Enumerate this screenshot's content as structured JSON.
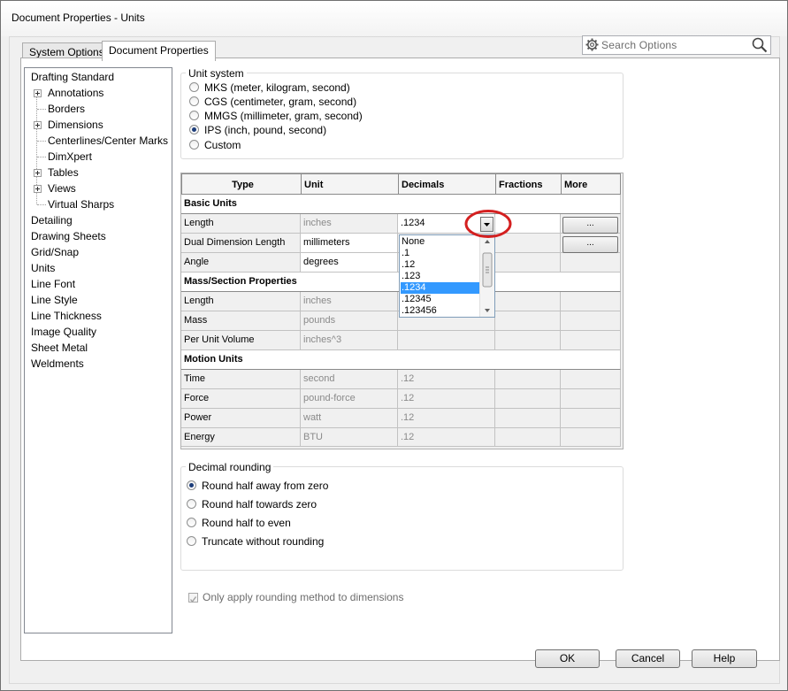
{
  "window": {
    "title": "Document Properties - Units"
  },
  "tabs": [
    {
      "label": "System Options",
      "active": false
    },
    {
      "label": "Document Properties",
      "active": true
    }
  ],
  "search": {
    "placeholder": "Search Options"
  },
  "tree": [
    {
      "label": "Drafting Standard",
      "level": 0
    },
    {
      "label": "Annotations",
      "level": 1,
      "expandable": true
    },
    {
      "label": "Borders",
      "level": 1
    },
    {
      "label": "Dimensions",
      "level": 1,
      "expandable": true
    },
    {
      "label": "Centerlines/Center Marks",
      "level": 1
    },
    {
      "label": "DimXpert",
      "level": 1
    },
    {
      "label": "Tables",
      "level": 1,
      "expandable": true
    },
    {
      "label": "Views",
      "level": 1,
      "expandable": true
    },
    {
      "label": "Virtual Sharps",
      "level": 1
    },
    {
      "label": "Detailing",
      "level": 0
    },
    {
      "label": "Drawing Sheets",
      "level": 0
    },
    {
      "label": "Grid/Snap",
      "level": 0
    },
    {
      "label": "Units",
      "level": 0,
      "selected": true
    },
    {
      "label": "Line Font",
      "level": 0
    },
    {
      "label": "Line Style",
      "level": 0
    },
    {
      "label": "Line Thickness",
      "level": 0
    },
    {
      "label": "Image Quality",
      "level": 0
    },
    {
      "label": "Sheet Metal",
      "level": 0
    },
    {
      "label": "Weldments",
      "level": 0
    }
  ],
  "unit_system": {
    "title": "Unit system",
    "options": [
      {
        "label": "MKS  (meter, kilogram, second)",
        "checked": false
      },
      {
        "label": "CGS  (centimeter, gram, second)",
        "checked": false
      },
      {
        "label": "MMGS  (millimeter, gram, second)",
        "checked": false
      },
      {
        "label": "IPS  (inch, pound, second)",
        "checked": true
      },
      {
        "label": "Custom",
        "checked": false
      }
    ]
  },
  "grid": {
    "headers": [
      "Type",
      "Unit",
      "Decimals",
      "Fractions",
      "More"
    ],
    "sections": {
      "basic": "Basic Units",
      "mass": "Mass/Section Properties",
      "motion": "Motion Units"
    },
    "rows": {
      "length": {
        "type": "Length",
        "unit": "inches",
        "decimals": ".1234"
      },
      "dual": {
        "type": "Dual Dimension Length",
        "unit": "millimeters"
      },
      "angle": {
        "type": "Angle",
        "unit": "degrees"
      },
      "mlength": {
        "type": "Length",
        "unit": "inches"
      },
      "mass": {
        "type": "Mass",
        "unit": "pounds"
      },
      "volume": {
        "type": "Per Unit Volume",
        "unit": "inches^3"
      },
      "time": {
        "type": "Time",
        "unit": "second",
        "decimals": ".12"
      },
      "force": {
        "type": "Force",
        "unit": "pound-force",
        "decimals": ".12"
      },
      "power": {
        "type": "Power",
        "unit": "watt",
        "decimals": ".12"
      },
      "energy": {
        "type": "Energy",
        "unit": "BTU",
        "decimals": ".12"
      }
    },
    "more_label": "...",
    "dropdown_options": [
      "None",
      ".1",
      ".12",
      ".123",
      ".1234",
      ".12345",
      ".123456"
    ],
    "dropdown_selected": ".1234"
  },
  "rounding": {
    "title": "Decimal rounding",
    "options": [
      {
        "label": "Round half away from zero",
        "checked": true
      },
      {
        "label": "Round half towards zero",
        "checked": false
      },
      {
        "label": "Round half to even",
        "checked": false
      },
      {
        "label": "Truncate without rounding",
        "checked": false
      }
    ],
    "only_apply_label": "Only apply rounding method to dimensions"
  },
  "buttons": {
    "ok": "OK",
    "cancel": "Cancel",
    "help": "Help"
  },
  "colors": {
    "selection": "#3399ff",
    "highlight_circle": "#d42020"
  }
}
